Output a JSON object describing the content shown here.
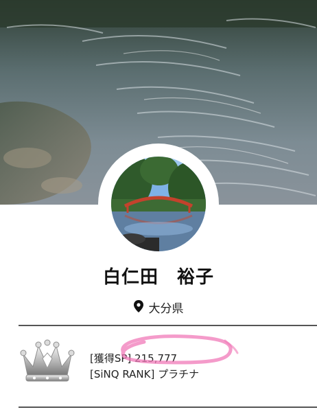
{
  "profile": {
    "name": "白仁田　裕子",
    "location": "大分県",
    "sp_label": "[獲得SP]",
    "sp_value": "215,777",
    "rank_label": "[SiNQ RANK]",
    "rank_value": "プラチナ"
  },
  "icons": {
    "location": "location-pin-icon",
    "rank": "platinum-crown-icon"
  },
  "colors": {
    "divider": "#555555",
    "highlight": "#f07ab8",
    "text": "#222222"
  }
}
